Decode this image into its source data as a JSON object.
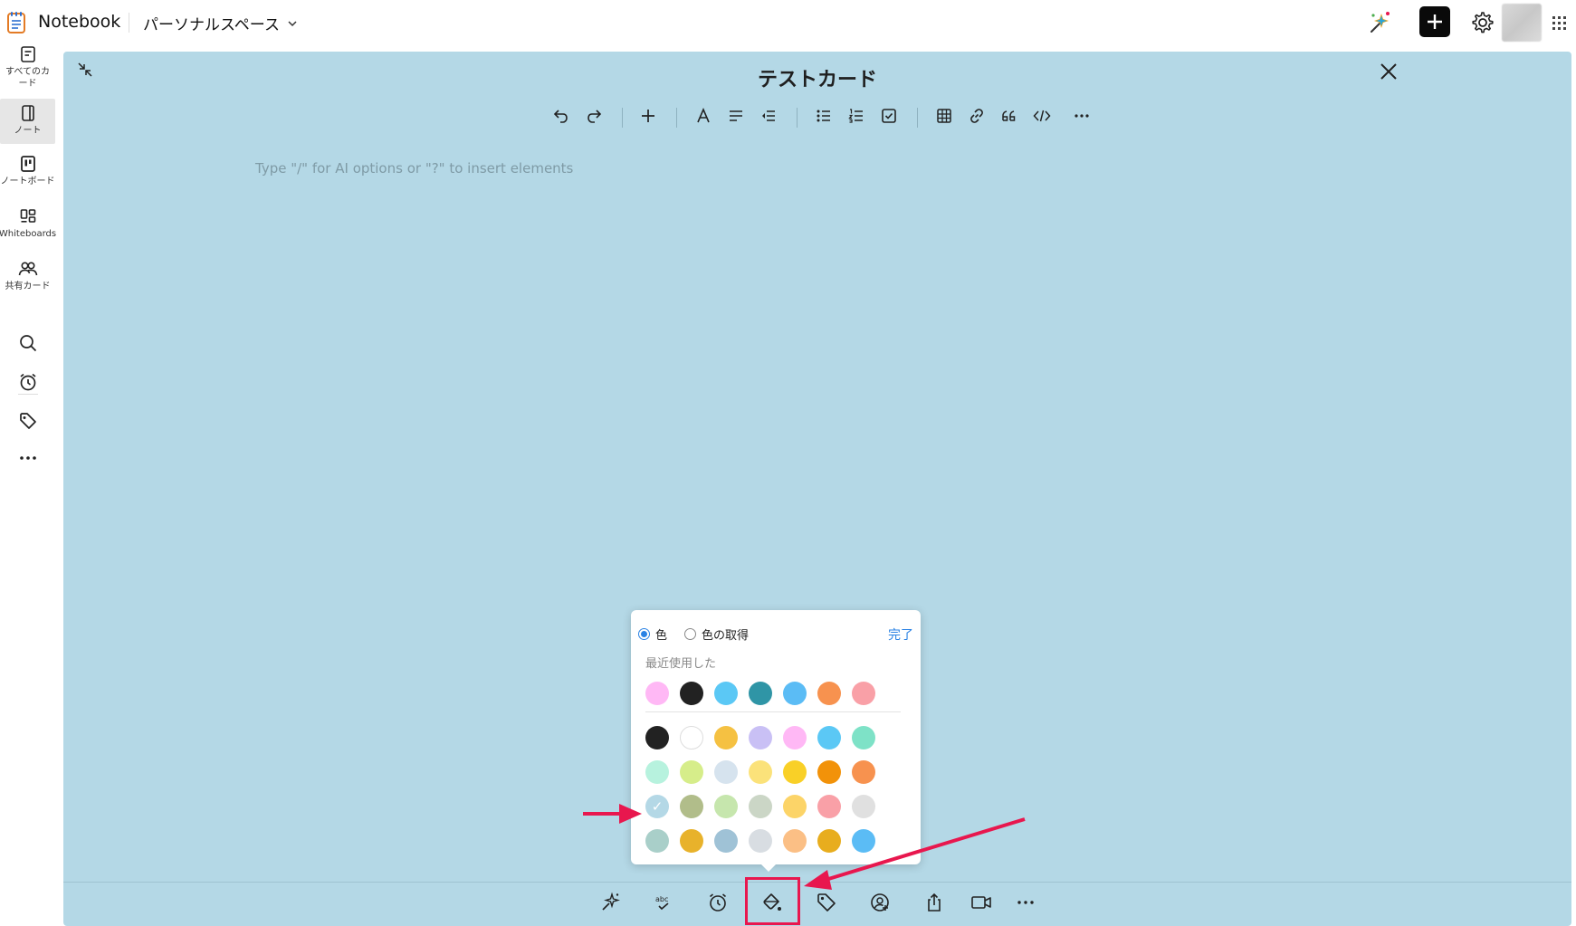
{
  "app": {
    "name": "Notebook",
    "space": "パーソナルスペース"
  },
  "sidebar": {
    "items": [
      {
        "label": "すべてのカード",
        "icon": "all-cards-icon"
      },
      {
        "label": "ノート",
        "icon": "note-icon",
        "active": true
      },
      {
        "label": "ノートボード",
        "icon": "noteboard-icon"
      },
      {
        "label": "Whiteboards",
        "icon": "whiteboard-icon"
      },
      {
        "label": "共有カード",
        "icon": "people-icon"
      }
    ],
    "tools": [
      "search-icon",
      "reminder-icon",
      "tag-icon",
      "more-icon"
    ]
  },
  "editor": {
    "title": "テストカード",
    "placeholder": "Type \"/\" for AI options or \"?\" to insert elements",
    "background_color": "#b4d8e6",
    "toolbar": [
      "undo-icon",
      "redo-icon",
      "insert-icon",
      "font-icon",
      "align-icon",
      "outdent-icon",
      "bullet-list-icon",
      "numbered-list-icon",
      "checklist-icon",
      "table-icon",
      "link-icon",
      "quote-icon",
      "code-icon",
      "more-icon"
    ],
    "bottom_toolbar": [
      "ai-sparkle-icon",
      "spellcheck-icon",
      "reminder-icon",
      "fill-color-icon",
      "tag-icon",
      "collaborator-icon",
      "share-icon",
      "video-icon",
      "more-icon"
    ]
  },
  "color_picker": {
    "option_color": "色",
    "option_eyedropper": "色の取得",
    "done": "完了",
    "recent_label": "最近使用した",
    "selected_mark": "✓",
    "recent": [
      "#ffb8f5",
      "#222222",
      "#5bc8f5",
      "#2f95a6",
      "#5bbcf5",
      "#f7924f",
      "#f9a0a7"
    ],
    "palette": [
      [
        "#222222",
        "#ffffff",
        "#f5c142",
        "#c9c0f5",
        "#ffb8f5",
        "#5bc8f5",
        "#7ee2c7"
      ],
      [
        "#b7f2de",
        "#d6ed8a",
        "#d6e3ee",
        "#fbe27a",
        "#f9d027",
        "#f29209",
        "#f7924f"
      ],
      [
        "#b4d8e6",
        "#b1bd8a",
        "#c6e6ad",
        "#cbd6c6",
        "#fcd468",
        "#f9a0a7",
        "#e0e0e0"
      ],
      [
        "#a9cfc9",
        "#e8b22b",
        "#9fc2d6",
        "#d8dde2",
        "#fbbf85",
        "#e8ad1e",
        "#5bbcf5"
      ]
    ],
    "selected": [
      2,
      0
    ]
  },
  "annotation": {
    "color": "#e8174e"
  }
}
